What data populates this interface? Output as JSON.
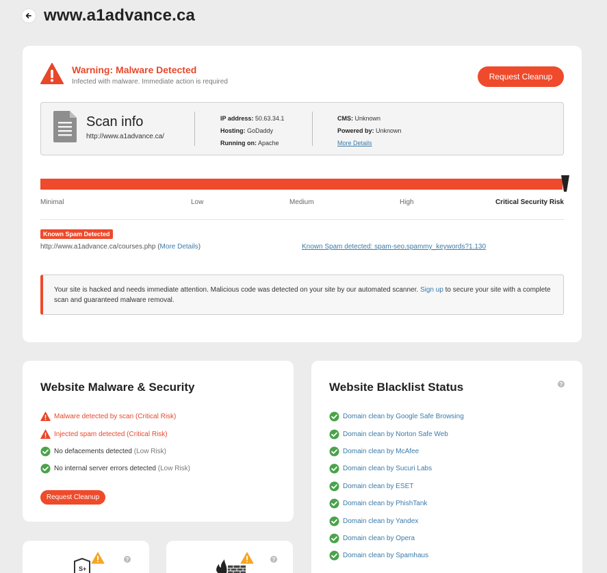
{
  "header": {
    "site": "www.a1advance.ca"
  },
  "warning": {
    "title": "Warning: Malware Detected",
    "subtitle": "Infected with malware. Immediate action is required",
    "cleanup_label": "Request Cleanup"
  },
  "scan": {
    "title": "Scan info",
    "url": "http://www.a1advance.ca/",
    "ip_label": "IP address:",
    "ip": "50.63.34.1",
    "hosting_label": "Hosting:",
    "hosting": "GoDaddy",
    "running_label": "Running on:",
    "running": "Apache",
    "cms_label": "CMS:",
    "cms": "Unknown",
    "powered_label": "Powered by:",
    "powered": "Unknown",
    "more_details": "More Details"
  },
  "risk": {
    "labels": [
      "Minimal",
      "Low",
      "Medium",
      "High",
      "Critical Security Risk"
    ],
    "level": "Critical Security Risk",
    "fill_percent": 100,
    "bar_color": "#ee4a2b"
  },
  "spam": {
    "badge": "Known Spam Detected",
    "url": "http://www.a1advance.ca/courses.php",
    "open_paren": " (",
    "more": "More Details",
    "close_paren": ")",
    "detail": "Known Spam detected: spam-seo.spammy_keywords?1.130"
  },
  "alert": {
    "text_before": "Your site is hacked and needs immediate attention. Malicious code was detected on your site by our automated scanner. ",
    "link": "Sign up",
    "text_after": " to secure your site with a complete scan and guaranteed malware removal."
  },
  "security": {
    "title": "Website Malware & Security",
    "items": [
      {
        "text": "Malware detected by scan",
        "risk": " (Critical Risk)",
        "status": "warning"
      },
      {
        "text": "Injected spam detected",
        "risk": " (Critical Risk)",
        "status": "warning"
      },
      {
        "text": "No defacements detected",
        "risk": " (Low Risk)",
        "status": "ok"
      },
      {
        "text": "No internal server errors detected",
        "risk": " (Low Risk)",
        "status": "ok"
      }
    ],
    "cleanup_label": "Request Cleanup"
  },
  "blacklist": {
    "title": "Website Blacklist Status",
    "help": "?",
    "items": [
      "Domain clean by Google Safe Browsing",
      "Domain clean by Norton Safe Web",
      "Domain clean by McAfee",
      "Domain clean by Sucuri Labs",
      "Domain clean by ESET",
      "Domain clean by PhishTank",
      "Domain clean by Yandex",
      "Domain clean by Opera",
      "Domain clean by Spamhaus"
    ]
  },
  "colors": {
    "accent": "#ee4a2b",
    "ok": "#4aa34a",
    "link": "#3b7aa8",
    "warn_yellow": "#f5a623"
  },
  "icons": {
    "back": "arrow-left-icon",
    "warning": "warning-triangle-icon",
    "check": "check-circle-icon",
    "help": "help-icon",
    "document": "document-icon"
  }
}
